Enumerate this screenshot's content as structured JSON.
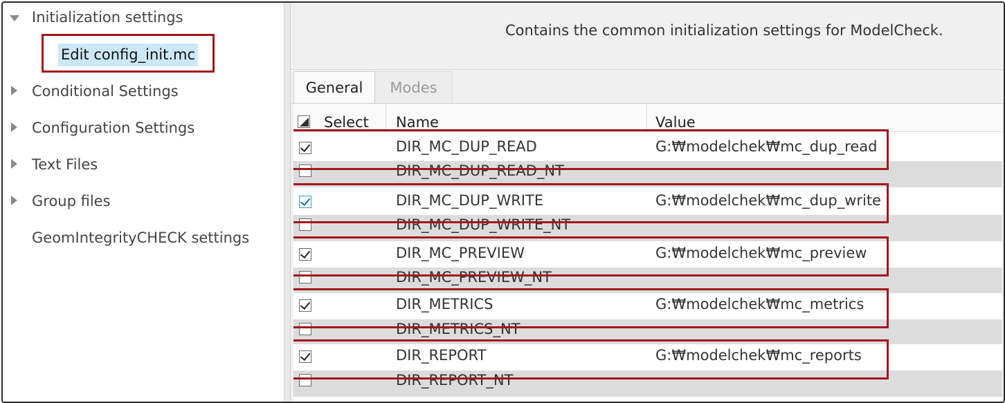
{
  "tree": {
    "items": [
      {
        "label": "Initialization settings",
        "expanded": true
      },
      {
        "label": "Conditional Settings",
        "expanded": false
      },
      {
        "label": "Configuration Settings",
        "expanded": false
      },
      {
        "label": "Text Files",
        "expanded": false
      },
      {
        "label": "Group files",
        "expanded": false
      },
      {
        "label": "GeomIntegrityCHECK settings",
        "expanded": null
      }
    ],
    "selected_child": "Edit config_init.mc"
  },
  "description": "Contains the common initialization settings for ModelCheck.",
  "tabs": [
    "General",
    "Modes"
  ],
  "active_tab": "General",
  "grid": {
    "columns": [
      "Select",
      "Name",
      "Value"
    ],
    "rows": [
      {
        "checked": true,
        "name": "DIR_MC_DUP_READ",
        "value": "G:₩modelchek₩mc_dup_read"
      },
      {
        "checked": false,
        "name": "DIR_MC_DUP_READ_NT",
        "value": ""
      },
      {
        "checked": true,
        "name": "DIR_MC_DUP_WRITE",
        "value": "G:₩modelchek₩mc_dup_write"
      },
      {
        "checked": false,
        "name": "DIR_MC_DUP_WRITE_NT",
        "value": ""
      },
      {
        "checked": true,
        "name": "DIR_MC_PREVIEW",
        "value": "G:₩modelchek₩mc_preview"
      },
      {
        "checked": false,
        "name": "DIR_MC_PREVIEW_NT",
        "value": ""
      },
      {
        "checked": true,
        "name": "DIR_METRICS",
        "value": "G:₩modelchek₩mc_metrics"
      },
      {
        "checked": false,
        "name": "DIR_METRICS_NT",
        "value": ""
      },
      {
        "checked": true,
        "name": "DIR_REPORT",
        "value": "G:₩modelchek₩mc_reports"
      },
      {
        "checked": false,
        "name": "DIR_REPORT_NT",
        "value": ""
      }
    ]
  },
  "colors": {
    "highlight_border": "#a3161b",
    "selection_bg": "#cce8f7",
    "alt_row": "#dcdcdc"
  }
}
